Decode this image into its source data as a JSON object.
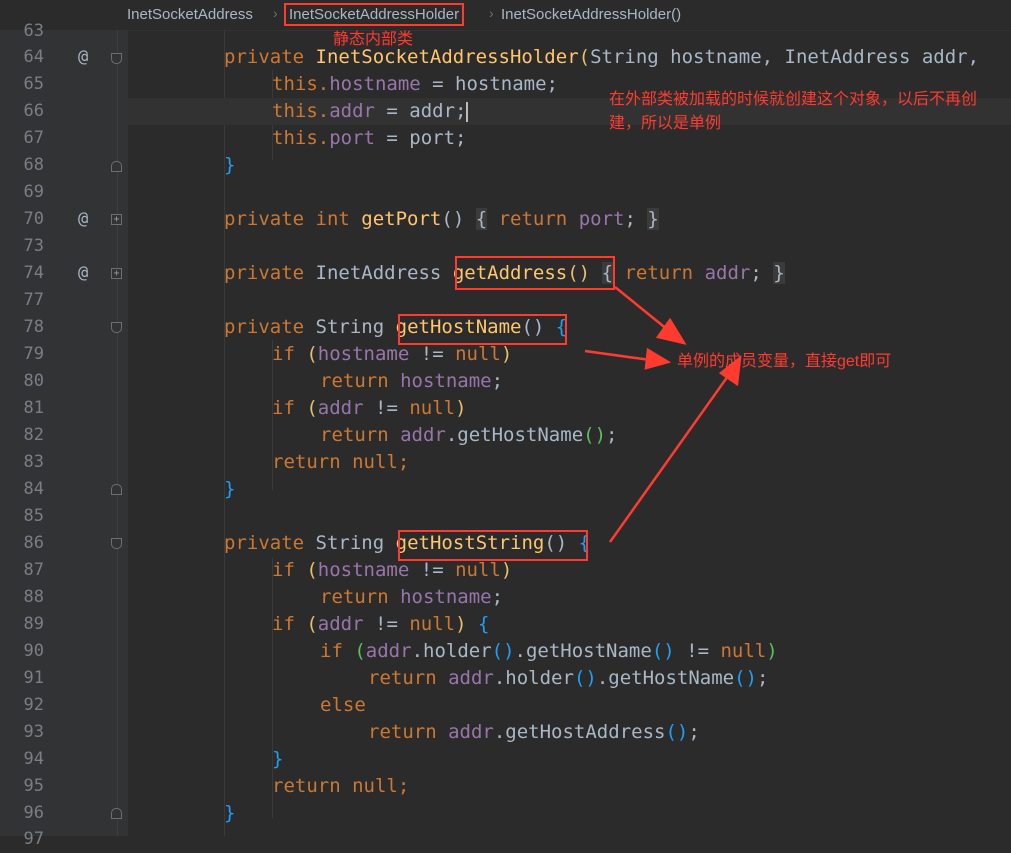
{
  "breadcrumb": {
    "items": [
      "InetSocketAddress",
      "InetSocketAddressHolder",
      "InetSocketAddressHolder()"
    ],
    "separator": "›"
  },
  "gutter": {
    "line_numbers": [
      "63",
      "64",
      "65",
      "66",
      "67",
      "68",
      "69",
      "70",
      "73",
      "74",
      "77",
      "78",
      "79",
      "80",
      "81",
      "82",
      "83",
      "84",
      "85",
      "86",
      "87",
      "88",
      "89",
      "90",
      "91",
      "92",
      "93",
      "94",
      "95",
      "96",
      "97"
    ],
    "override_marker": "@"
  },
  "code": {
    "l63": "",
    "l64_kw": "private",
    "l64_fn": "InetSocketAddressHolder",
    "l64_rest": "String hostname, InetAddress addr,",
    "l65_this": "this.",
    "l65_fld": "hostname",
    "l65_rest": " = hostname;",
    "l66_this": "this.",
    "l66_fld": "addr",
    "l66_rest": " = addr;",
    "l67_this": "this.",
    "l67_fld": "port",
    "l67_rest": " = port;",
    "l68": "}",
    "l70_kw": "private int",
    "l70_fn": "getPort",
    "l70_ret": "return",
    "l70_fld": "port",
    "l74_kw": "private",
    "l74_type": "InetAddress",
    "l74_fn": "getAddress",
    "l74_ret": "return",
    "l74_fld": "addr",
    "l78_kw": "private",
    "l78_type": "String",
    "l78_fn": "getHostName",
    "l79_kw": "if",
    "l79_fld": "hostname",
    "l79_op": " != ",
    "l79_null": "null",
    "l80_kw": "return",
    "l80_fld": "hostname",
    "l81_kw": "if",
    "l81_fld": "addr",
    "l81_null": "null",
    "l82_kw": "return",
    "l82_fld": "addr",
    "l82_call": ".getHostName",
    "l83_kw": "return",
    "l83_null": "null",
    "l86_kw": "private",
    "l86_type": "String",
    "l86_fn": "getHostString",
    "l87_kw": "if",
    "l87_fld": "hostname",
    "l87_null": "null",
    "l88_kw": "return",
    "l88_fld": "hostname",
    "l89_kw": "if",
    "l89_fld": "addr",
    "l89_null": "null",
    "l90_kw": "if",
    "l90_fld": "addr",
    "l90_call1": ".holder",
    "l90_call2": ".getHostName",
    "l90_null": "null",
    "l91_kw": "return",
    "l91_fld": "addr",
    "l91_call1": ".holder",
    "l91_call2": ".getHostName",
    "l92_kw": "else",
    "l93_kw": "return",
    "l93_fld": "addr",
    "l93_call": ".getHostAddress",
    "l95_kw": "return",
    "l95_null": "null"
  },
  "annotations": {
    "static_inner_class": "静态内部类",
    "created_once": "在外部类被加载的时候就创建这个对象，以后不再创建，所以是单例",
    "singleton_member": "单例的成员变量，直接get即可"
  },
  "colors": {
    "background": "#2b2b2b",
    "gutter": "#313335",
    "keyword": "#cc7832",
    "function": "#ffc66d",
    "field": "#9876aa",
    "plain": "#a9b7c6",
    "annotation_red": "#ff3b30"
  }
}
